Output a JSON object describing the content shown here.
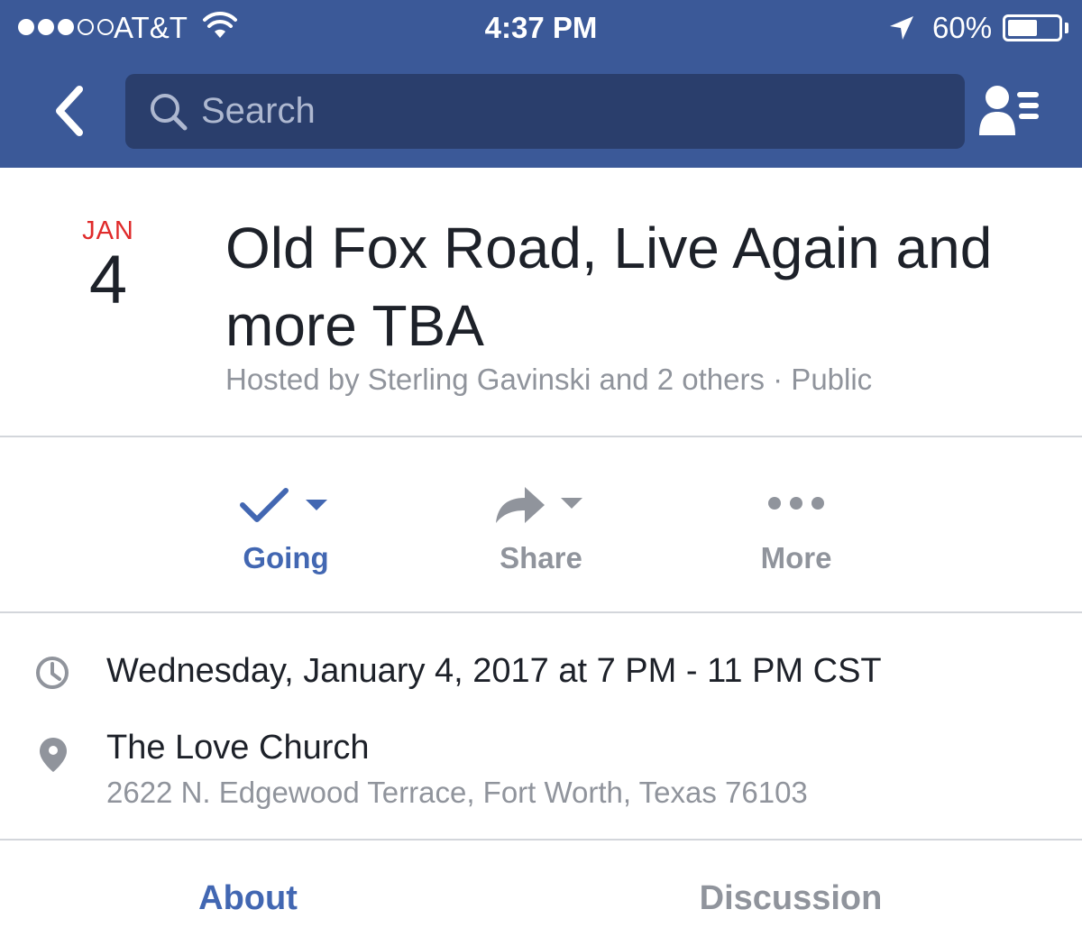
{
  "status_bar": {
    "carrier": "AT&T",
    "time": "4:37 PM",
    "battery_percent": "60%",
    "battery_level": 0.6,
    "signal_bars_filled": 3,
    "signal_bars_total": 5
  },
  "nav": {
    "search_placeholder": "Search"
  },
  "event": {
    "month": "JAN",
    "day": "4",
    "title": "Old Fox Road, Live Again and more TBA",
    "host_line": "Hosted by Sterling Gavinski and 2 others · Public"
  },
  "actions": {
    "going_label": "Going",
    "share_label": "Share",
    "more_label": "More"
  },
  "details": {
    "when": "Wednesday, January 4, 2017 at 7 PM - 11 PM CST",
    "place_name": "The Love Church",
    "place_address": "2622 N. Edgewood Terrace, Fort Worth, Texas 76103"
  },
  "tabs": {
    "about": "About",
    "discussion": "Discussion"
  },
  "colors": {
    "header_bg": "#3b5998",
    "search_bg": "#2a3e6c",
    "accent": "#4267b2",
    "date_month": "#e02b2b",
    "muted_text": "#90949c"
  },
  "icons": [
    "back-chevron-icon",
    "search-icon",
    "friend-requests-icon",
    "wifi-icon",
    "location-arrow-icon",
    "checkmark-icon",
    "share-arrow-icon",
    "more-dots-icon",
    "clock-icon",
    "map-pin-icon"
  ]
}
